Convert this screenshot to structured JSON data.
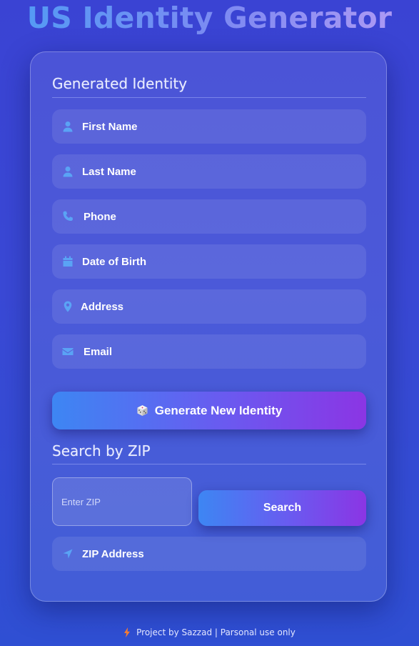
{
  "app": {
    "title": "US Identity Generator"
  },
  "identity": {
    "heading": "Generated Identity",
    "fields": [
      {
        "label": "First Name",
        "icon": "user-icon"
      },
      {
        "label": "Last Name",
        "icon": "user-icon"
      },
      {
        "label": "Phone",
        "icon": "phone-icon"
      },
      {
        "label": "Date of Birth",
        "icon": "calendar-icon"
      },
      {
        "label": "Address",
        "icon": "map-pin-icon"
      },
      {
        "label": "Email",
        "icon": "envelope-icon"
      }
    ],
    "generate_button": {
      "label": "Generate New Identity",
      "icon": "dice-icon"
    }
  },
  "zip_search": {
    "heading": "Search by ZIP",
    "input_placeholder": "Enter ZIP",
    "input_value": "",
    "search_button": "Search",
    "result_label": "ZIP Address",
    "result_icon": "location-arrow-icon"
  },
  "footer": {
    "text": "Project by Sazzad | Parsonal use only",
    "icon": "lightning-icon"
  },
  "colors": {
    "background_top": "#3a43d3",
    "background_bottom": "#2f4fd3",
    "icon_accent": "#5aa3f5",
    "button_gradient_start": "#3d86f3",
    "button_gradient_end": "#8b35e4"
  }
}
